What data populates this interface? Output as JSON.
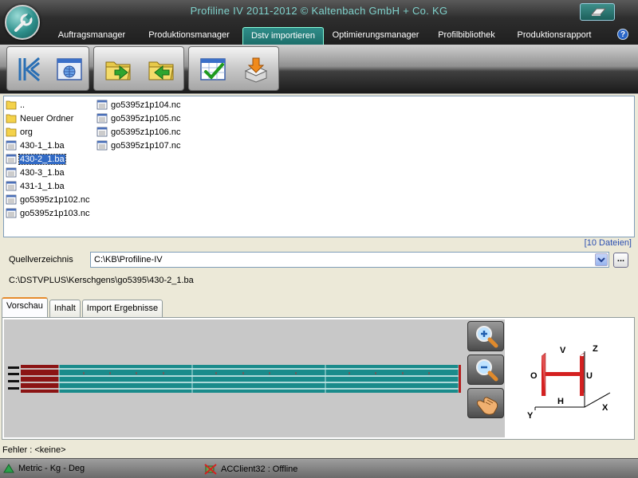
{
  "app": {
    "title": "Profiline IV 2011-2012 © Kaltenbach GmbH + Co. KG"
  },
  "menu": [
    {
      "label": "Auftragsmanager",
      "active": false
    },
    {
      "label": "Produktionsmanager",
      "active": false
    },
    {
      "label": "Dstv importieren",
      "active": true
    },
    {
      "label": "Optimierungsmanager",
      "active": false
    },
    {
      "label": "Profilbibliothek",
      "active": false
    },
    {
      "label": "Produktionsrapport",
      "active": false
    }
  ],
  "help_icon": "?",
  "toolbar": {
    "icons": [
      "dstv-logo-icon",
      "web-browser-icon",
      "folder-import-icon",
      "folder-export-icon",
      "checklist-icon",
      "import-install-icon"
    ]
  },
  "files": {
    "column1": [
      {
        "name": "..",
        "type": "folder"
      },
      {
        "name": "Neuer Ordner",
        "type": "folder"
      },
      {
        "name": "org",
        "type": "folder"
      },
      {
        "name": "430-1_1.ba",
        "type": "file"
      },
      {
        "name": "430-2_1.ba",
        "type": "file",
        "selected": true
      },
      {
        "name": "430-3_1.ba",
        "type": "file"
      },
      {
        "name": "431-1_1.ba",
        "type": "file"
      },
      {
        "name": "go5395z1p102.nc",
        "type": "file"
      },
      {
        "name": "go5395z1p103.nc",
        "type": "file"
      }
    ],
    "column2": [
      {
        "name": "go5395z1p104.nc",
        "type": "file"
      },
      {
        "name": "go5395z1p105.nc",
        "type": "file"
      },
      {
        "name": "go5395z1p106.nc",
        "type": "file"
      },
      {
        "name": "go5395z1p107.nc",
        "type": "file"
      }
    ],
    "count_label": "[10 Dateien]"
  },
  "source": {
    "label": "Quellverzeichnis",
    "value": "C:\\KB\\Profiline-IV",
    "browse_label": "...",
    "current_path": "C:\\DSTVPLUS\\Kerschgens\\go5395\\430-2_1.ba"
  },
  "tabs": [
    {
      "label": "Vorschau",
      "active": true
    },
    {
      "label": "Inhalt",
      "active": false
    },
    {
      "label": "Import Ergebnisse",
      "active": false
    }
  ],
  "diagram": {
    "labels": {
      "v": "V",
      "z": "Z",
      "o": "O",
      "u": "U",
      "h": "H",
      "y": "Y",
      "x": "X"
    }
  },
  "status": {
    "error_line": "Fehler : <keine>",
    "units": "Metric - Kg - Deg",
    "client": "ACClient32 : Offline"
  },
  "colors": {
    "accent_teal": "#2b8f8b",
    "profile_red": "#8b1414",
    "profile_teal": "#1a8b8b",
    "diagram_red": "#d42020",
    "selection_blue": "#316ac5"
  }
}
